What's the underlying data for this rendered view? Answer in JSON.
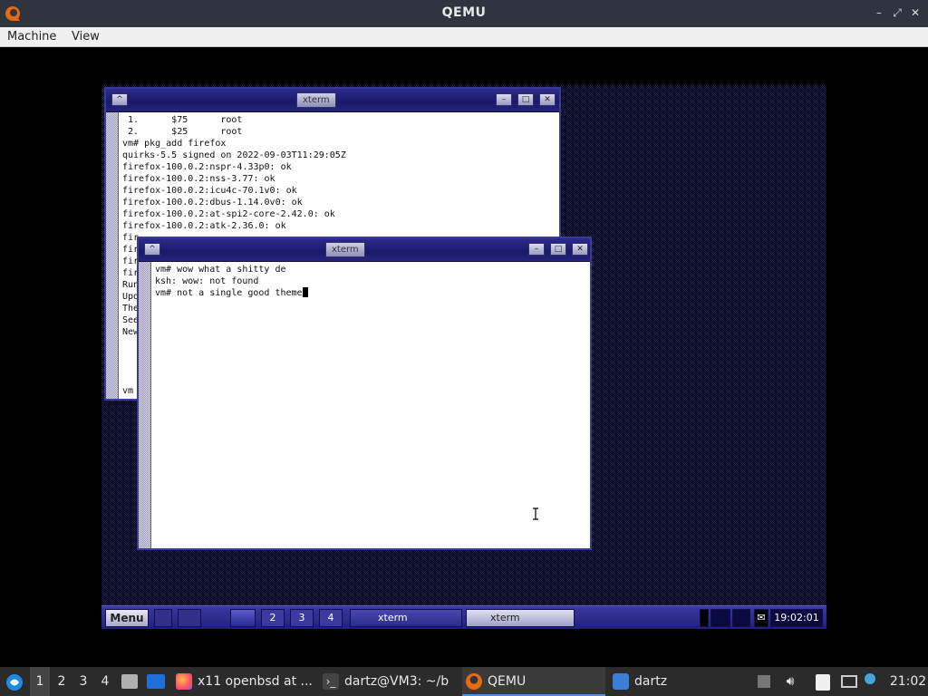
{
  "qemu": {
    "title": "QEMU",
    "menu": [
      "Machine",
      "View"
    ],
    "controls": {
      "minimize": "–",
      "restore": "⤢",
      "close": "✕"
    }
  },
  "guest": {
    "xterm_back": {
      "title": "xterm",
      "lines": [
        " 1.      $75      root",
        " 2.      $25      root",
        "vm# pkg_add firefox",
        "quirks-5.5 signed on 2022-09-03T11:29:05Z",
        "firefox-100.0.2:nspr-4.33p0: ok",
        "firefox-100.0.2:nss-3.77: ok",
        "firefox-100.0.2:icu4c-70.1v0: ok",
        "firefox-100.0.2:dbus-1.14.0v0: ok",
        "firefox-100.0.2:at-spi2-core-2.42.0: ok",
        "firefox-100.0.2:atk-2.36.0: ok",
        "fir",
        "fir",
        "fir",
        "fir",
        "Run",
        "Upd",
        "The",
        "See",
        "New",
        "",
        "",
        "",
        "",
        "vm"
      ]
    },
    "xterm_front": {
      "title": "xterm",
      "lines": [
        "vm# wow what a shitty de",
        "ksh: wow: not found"
      ],
      "current_line": "vm# not a single good theme"
    },
    "taskbar": {
      "menu_label": "Menu",
      "workspaces": [
        "2",
        "3",
        "4"
      ],
      "tasks": [
        "xterm",
        "xterm"
      ],
      "clock": "19:02:01"
    }
  },
  "host_taskbar": {
    "workspaces": [
      "1",
      "2",
      "3",
      "4"
    ],
    "tasks": [
      {
        "label": "x11 openbsd at ...",
        "icon": "firefox-icon"
      },
      {
        "label": "dartz@VM3: ~/b",
        "icon": "terminal-icon"
      },
      {
        "label": "QEMU",
        "icon": "qemu-icon"
      },
      {
        "label": "dartz",
        "icon": "folder-icon"
      }
    ],
    "clock": "21:02"
  }
}
